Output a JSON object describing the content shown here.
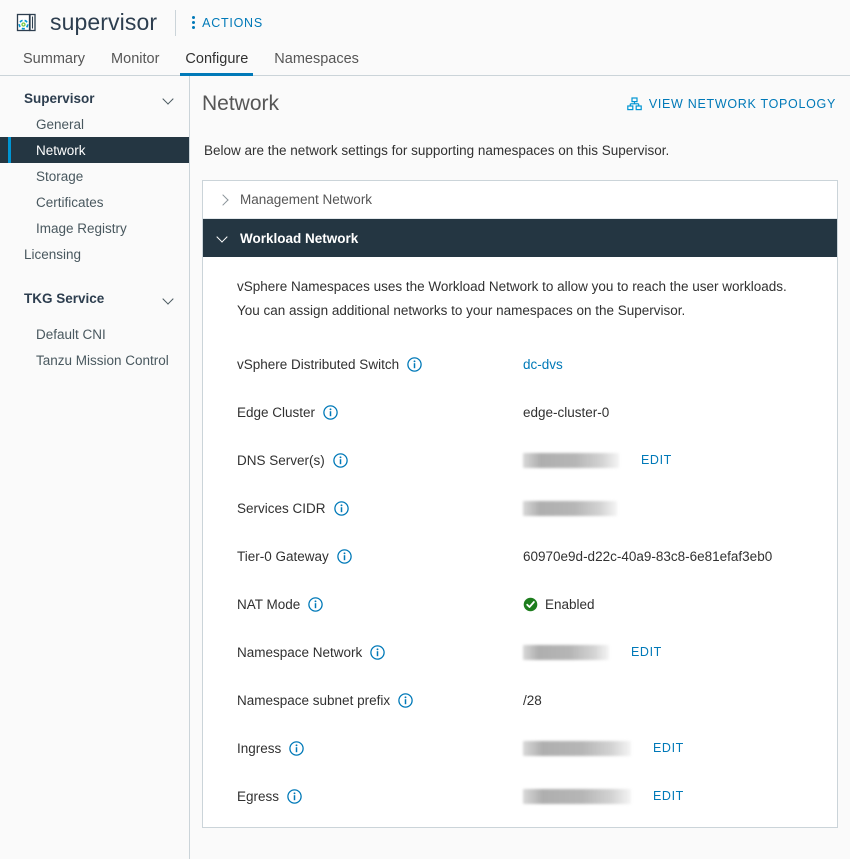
{
  "header": {
    "object_icon": "supervisor-cluster-icon",
    "title": "supervisor",
    "actions_label": "ACTIONS",
    "actions_icon": "kebab-menu-icon"
  },
  "tabs": [
    {
      "label": "Summary",
      "active": false
    },
    {
      "label": "Monitor",
      "active": false
    },
    {
      "label": "Configure",
      "active": true
    },
    {
      "label": "Namespaces",
      "active": false
    }
  ],
  "sidebar": {
    "groups": [
      {
        "label": "Supervisor",
        "icon": "chevron-down-icon",
        "items": [
          {
            "label": "General",
            "selected": false
          },
          {
            "label": "Network",
            "selected": true
          },
          {
            "label": "Storage",
            "selected": false
          },
          {
            "label": "Certificates",
            "selected": false
          },
          {
            "label": "Image Registry",
            "selected": false
          }
        ]
      }
    ],
    "licensing_label": "Licensing",
    "tkg_group": {
      "label": "TKG Service",
      "icon": "chevron-down-icon",
      "items": [
        {
          "label": "Default CNI",
          "selected": false
        },
        {
          "label": "Tanzu Mission Control",
          "selected": false
        }
      ]
    }
  },
  "main": {
    "page_title": "Network",
    "topology_link": "VIEW NETWORK TOPOLOGY",
    "topology_icon": "sitemap-icon",
    "subtitle": "Below are the network settings for supporting namespaces on this Supervisor."
  },
  "accordions": [
    {
      "label": "Management Network",
      "expanded": false,
      "icon": "chevron-right-icon"
    },
    {
      "label": "Workload Network",
      "expanded": true,
      "icon": "chevron-down-icon",
      "description": "vSphere Namespaces uses the Workload Network to allow you to reach the user workloads. You can assign additional networks to your namespaces on the Supervisor.",
      "rows": [
        {
          "label": "vSphere Distributed Switch",
          "info_icon": "info-icon",
          "value": "dc-dvs",
          "value_type": "link",
          "redacted_width": 0,
          "edit_label": ""
        },
        {
          "label": "Edge Cluster",
          "info_icon": "info-icon",
          "value": "edge-cluster-0",
          "value_type": "text",
          "redacted_width": 0,
          "edit_label": ""
        },
        {
          "label": "DNS Server(s)",
          "info_icon": "info-icon",
          "value": "",
          "value_type": "redacted",
          "redacted_width": 96,
          "edit_label": "EDIT"
        },
        {
          "label": "Services CIDR",
          "info_icon": "info-icon",
          "value": "",
          "value_type": "redacted",
          "redacted_width": 94,
          "edit_label": ""
        },
        {
          "label": "Tier-0 Gateway",
          "info_icon": "info-icon",
          "value": "60970e9d-d22c-40a9-83c8-6e81efaf3eb0",
          "value_type": "text",
          "redacted_width": 0,
          "edit_label": ""
        },
        {
          "label": "NAT Mode",
          "info_icon": "info-icon",
          "value": "Enabled",
          "value_type": "status",
          "status_icon": "check-circle-icon",
          "redacted_width": 0,
          "edit_label": ""
        },
        {
          "label": "Namespace Network",
          "info_icon": "info-icon",
          "value": "",
          "value_type": "redacted",
          "redacted_width": 86,
          "edit_label": "EDIT"
        },
        {
          "label": "Namespace subnet prefix",
          "info_icon": "info-icon",
          "value": "/28",
          "value_type": "text",
          "redacted_width": 0,
          "edit_label": ""
        },
        {
          "label": "Ingress",
          "info_icon": "info-icon",
          "value": "",
          "value_type": "redacted",
          "redacted_width": 108,
          "edit_label": "EDIT"
        },
        {
          "label": "Egress",
          "info_icon": "info-icon",
          "value": "",
          "value_type": "redacted",
          "redacted_width": 108,
          "edit_label": "EDIT"
        }
      ]
    }
  ],
  "colors": {
    "accent_blue": "#0079b8",
    "dark_navy": "#243642",
    "selected_bar": "#0095d3",
    "status_green": "#1d7d1d",
    "border": "#cbd4d9"
  }
}
